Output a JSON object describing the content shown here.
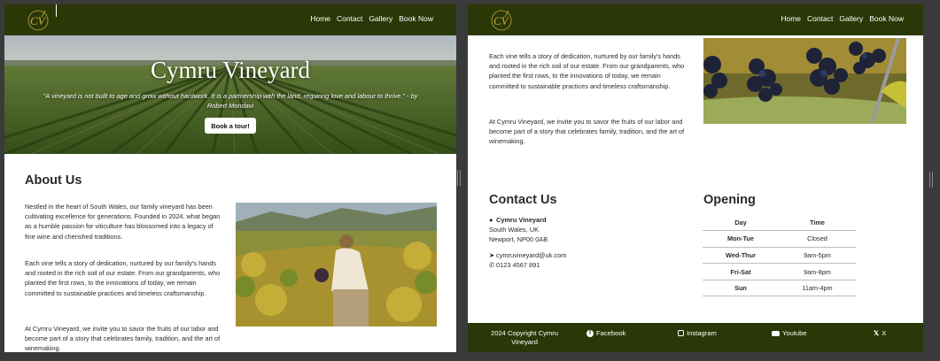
{
  "nav": {
    "logo_text": "CV",
    "links": [
      "Home",
      "Contact",
      "Gallery",
      "Book Now"
    ]
  },
  "hero": {
    "title": "Cymru Vineyard",
    "quote": "\"A vineyard is not built to age and grow without hardwork. It is a partnership with the land, requiring love and labour to thrive.\" - by Robert Mondavi",
    "button": "Book a tour!"
  },
  "about": {
    "title": "About Us",
    "p1": "Nestled in the heart of South Wales, our family vineyard has been cultivating excellence for generations. Founded in 2024, what began as a humble passion for viticulture has blossomed into a legacy of fine wine and cherished traditions.",
    "p2": "Each vine tells a story of dedication, nurtured by our family's hands and rooted in the rich soil of our estate. From our grandparents, who planted the first rows, to the innovations of today, we remain committed to sustainable practices and timeless craftsmanship.",
    "p3": "At Cymru Vineyard, we invite you to savor the fruits of our labor and become part of a story that celebrates family, tradition, and the art of winemaking."
  },
  "contact": {
    "title": "Contact Us",
    "name": "Cymru Vineyard",
    "line1": "South Wales, UK",
    "line2": "Newport, NP00 0AB",
    "email": "cymruvineyard@uk.com",
    "phone": "0123 4567 891"
  },
  "opening": {
    "title": "Opening",
    "headers": [
      "Day",
      "Time"
    ],
    "rows": [
      {
        "day": "Mon-Tue",
        "time": "Closed"
      },
      {
        "day": "Wed-Thur",
        "time": "9am-5pm"
      },
      {
        "day": "Fri-Sat",
        "time": "9am-8pm"
      },
      {
        "day": "Sun",
        "time": "11am-4pm"
      }
    ]
  },
  "footer": {
    "copyright": "2024 Copyright Cymru Vineyard",
    "facebook": "Facebook",
    "instagram": "Instagram",
    "youtube": "Youtube",
    "x": "X"
  },
  "colors": {
    "brand": "#2a3706",
    "accent": "#c9a93c"
  }
}
